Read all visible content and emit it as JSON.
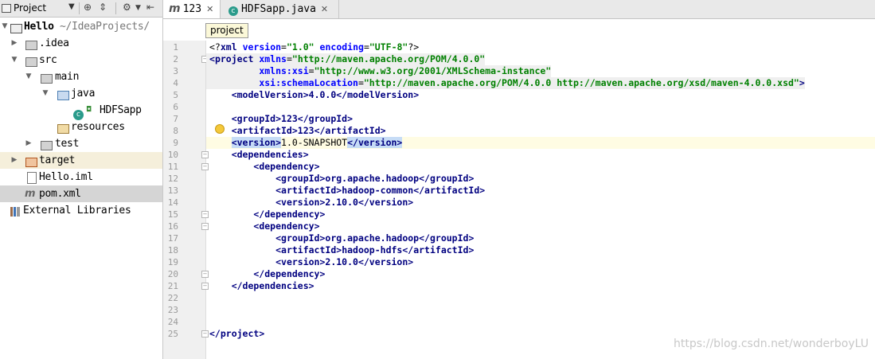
{
  "project_panel": {
    "title": "Project",
    "tree": [
      {
        "label": "Hello",
        "path": " ~/IdeaProjects/"
      },
      {
        "label": ".idea"
      },
      {
        "label": "src"
      },
      {
        "label": "main"
      },
      {
        "label": "java"
      },
      {
        "label": "HDFSapp"
      },
      {
        "label": "resources"
      },
      {
        "label": "test"
      },
      {
        "label": "target"
      },
      {
        "label": "Hello.iml"
      },
      {
        "label": "pom.xml"
      },
      {
        "label": "External Libraries"
      }
    ]
  },
  "tabs": [
    {
      "label": "123",
      "icon": "maven-m-icon",
      "active": true
    },
    {
      "label": "HDFSapp.java",
      "icon": "java-class-icon",
      "active": false
    }
  ],
  "breadcrumb": "project",
  "line_numbers": [
    "1",
    "2",
    "3",
    "4",
    "5",
    "6",
    "7",
    "8",
    "9",
    "10",
    "11",
    "12",
    "13",
    "14",
    "15",
    "16",
    "17",
    "18",
    "19",
    "20",
    "21",
    "22",
    "23",
    "24",
    "25"
  ],
  "code": {
    "l1": {
      "a": "<?",
      "b": "xml",
      "c": " ",
      "d": "version",
      "e": "=",
      "f": "\"1.0\"",
      "g": " ",
      "h": "encoding",
      "i": "=",
      "j": "\"UTF-8\"",
      "k": "?>"
    },
    "l2": {
      "a": "<",
      "b": "project",
      "c": " ",
      "d": "xmlns",
      "e": "=",
      "f": "\"http://maven.apache.org/POM/4.0.0\""
    },
    "l3": {
      "a": "         ",
      "b": "xmlns:xsi",
      "c": "=",
      "d": "\"http://www.w3.org/2001/XMLSchema-instance\""
    },
    "l4": {
      "a": "         ",
      "b": "xsi:schemaLocation",
      "c": "=",
      "d": "\"http://maven.apache.org/POM/4.0.0 http://maven.apache.org/xsd/maven-4.0.0.xsd\"",
      "e": ">"
    },
    "l5": {
      "a": "    <",
      "b": "modelVersion",
      "c": ">4.0.0</",
      "d": "modelVersion",
      "e": ">"
    },
    "l7": {
      "a": "    <",
      "b": "groupId",
      "c": ">123</",
      "d": "groupId",
      "e": ">"
    },
    "l8": {
      "a": "    <",
      "b": "artifactId",
      "c": ">123</",
      "d": "artifactId",
      "e": ">"
    },
    "l9": {
      "a": "    ",
      "b": "<version>",
      "c": "1.0-SNAPSHOT",
      "d": "</version>"
    },
    "l10": {
      "a": "    <",
      "b": "dependencies",
      "c": ">"
    },
    "l11": {
      "a": "        <",
      "b": "dependency",
      "c": ">"
    },
    "l12": {
      "a": "            <",
      "b": "groupId",
      "c": ">org.apache.hadoop</",
      "d": "groupId",
      "e": ">"
    },
    "l13": {
      "a": "            <",
      "b": "artifactId",
      "c": ">hadoop-common</",
      "d": "artifactId",
      "e": ">"
    },
    "l14": {
      "a": "            <",
      "b": "version",
      "c": ">2.10.0</",
      "d": "version",
      "e": ">"
    },
    "l15": {
      "a": "        </",
      "b": "dependency",
      "c": ">"
    },
    "l16": {
      "a": "        <",
      "b": "dependency",
      "c": ">"
    },
    "l17": {
      "a": "            <",
      "b": "groupId",
      "c": ">org.apache.hadoop</",
      "d": "groupId",
      "e": ">"
    },
    "l18": {
      "a": "            <",
      "b": "artifactId",
      "c": ">hadoop-hdfs</",
      "d": "artifactId",
      "e": ">"
    },
    "l19": {
      "a": "            <",
      "b": "version",
      "c": ">2.10.0</",
      "d": "version",
      "e": ">"
    },
    "l20": {
      "a": "        </",
      "b": "dependency",
      "c": ">"
    },
    "l21": {
      "a": "    </",
      "b": "dependencies",
      "c": ">"
    },
    "l25": {
      "a": "</",
      "b": "project",
      "c": ">"
    }
  },
  "watermark": "https://blog.csdn.net/wonderboyLU"
}
